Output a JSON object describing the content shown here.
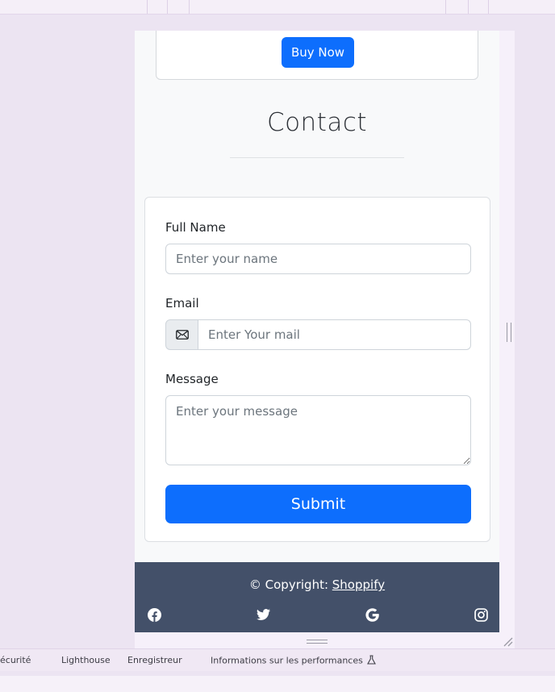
{
  "product": {
    "buy_label": "Buy Now"
  },
  "contact": {
    "title": "Contact",
    "full_name": {
      "label": "Full Name",
      "placeholder": "Enter your name"
    },
    "email": {
      "label": "Email",
      "placeholder": "Enter Your mail",
      "icon": "envelope-icon"
    },
    "message": {
      "label": "Message",
      "placeholder": "Enter your message"
    },
    "submit_label": "Submit"
  },
  "footer": {
    "copyright_prefix": "© Copyright: ",
    "brand_link": "Shoppify",
    "social_icons": [
      "facebook-icon",
      "twitter-icon",
      "google-icon",
      "instagram-icon"
    ]
  },
  "devtools": {
    "tabs": [
      "écurité",
      "Lighthouse",
      "Enregistreur",
      "Informations sur les performances"
    ]
  },
  "colors": {
    "primary": "#0d6efd",
    "footer_bg": "#435069",
    "page_bg": "#f8f9fa",
    "devtools_bg": "#ece4f2"
  }
}
